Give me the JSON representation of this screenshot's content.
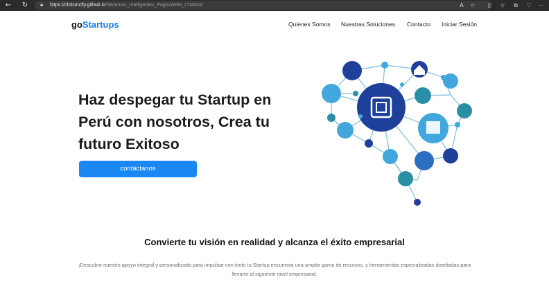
{
  "browser": {
    "back_icon": "arrow-left-icon",
    "refresh_icon": "refresh-icon",
    "url_host": "https://chrismcfly.github.io",
    "url_path": "/Sistemas_Inteligentes_PaginaWeb_Chatbot/"
  },
  "header": {
    "logo_prefix": "go",
    "logo_accent": "Startups",
    "nav": [
      "Quienes Somos",
      "Nuestras Soluciones",
      "Contacto",
      "Iniciar Sesión"
    ]
  },
  "hero": {
    "title": "Haz despegar tu Startup en Perú con nosotros, Crea tu futuro Exitoso",
    "cta_label": "contáctanos",
    "illustration": "network-brain-icons"
  },
  "section": {
    "title": "Convierte tu visión en realidad y alcanza el éxito empresarial",
    "text": "¡Descubre nuestro apoyo integral y personalizado para impulsar con éxito tu Startup encuentra una amplia gama de recursos, y herramientas especializadas diseñadas para llevarte al siguiente nivel empresarial."
  },
  "colors": {
    "brand_blue": "#1a87f2",
    "logo_blue": "#1a7fe8",
    "network_dark": "#1e3f9a",
    "network_light": "#41a7dd",
    "network_teal": "#2a8fa4"
  }
}
